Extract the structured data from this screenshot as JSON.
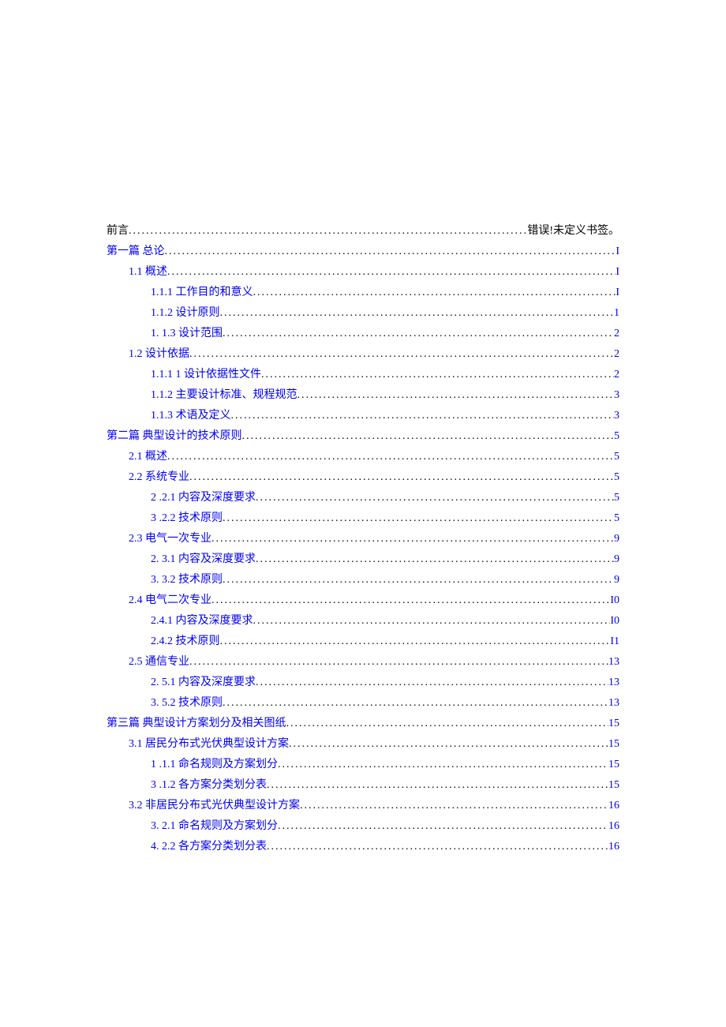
{
  "toc": [
    {
      "indent": 0,
      "title": "前言",
      "page": "错误!未定义书签。",
      "titleLink": false,
      "pageLink": false
    },
    {
      "indent": 0,
      "title": "第一篇 总论",
      "page": "I",
      "titleLink": true,
      "pageLink": true
    },
    {
      "indent": 1,
      "title": "1.1 概述",
      "page": "I",
      "titleLink": true,
      "pageLink": true
    },
    {
      "indent": 2,
      "title": "1.1.1 工作目的和意义",
      "page": "I",
      "titleLink": true,
      "pageLink": true
    },
    {
      "indent": 2,
      "title": "1.1.2 设计原则",
      "page": "1",
      "titleLink": true,
      "pageLink": true
    },
    {
      "indent": 2,
      "title": "1.  1.3 设计范围",
      "page": "2",
      "titleLink": true,
      "pageLink": true
    },
    {
      "indent": 1,
      "title": "1.2 设计依据",
      "page": "2",
      "titleLink": true,
      "pageLink": true
    },
    {
      "indent": 2,
      "title": "1.1.1 1 设计依据性文件",
      "page": "2",
      "titleLink": true,
      "pageLink": true
    },
    {
      "indent": 2,
      "title": "1.1.2  主要设计标准、规程规范",
      "page": "3",
      "titleLink": true,
      "pageLink": true
    },
    {
      "indent": 2,
      "title": "1.1.3  术语及定义",
      "page": "3",
      "titleLink": true,
      "pageLink": true
    },
    {
      "indent": 0,
      "title": "第二篇 典型设计的技术原则",
      "page": "5",
      "titleLink": true,
      "pageLink": true
    },
    {
      "indent": 1,
      "title": "2.1   概述",
      "page": "5",
      "titleLink": true,
      "pageLink": true
    },
    {
      "indent": 1,
      "title": "2.2   系统专业",
      "page": "5",
      "titleLink": true,
      "pageLink": true
    },
    {
      "indent": 2,
      "title": "2  .2.1 内容及深度要求",
      "page": "5",
      "titleLink": true,
      "pageLink": true
    },
    {
      "indent": 2,
      "title": "3  .2.2 技术原则",
      "page": "5",
      "titleLink": true,
      "pageLink": true
    },
    {
      "indent": 1,
      "title": "2.3   电气一次专业",
      "page": "9",
      "titleLink": true,
      "pageLink": true
    },
    {
      "indent": 2,
      "title": "2.  3.1 内容及深度要求",
      "page": "9",
      "titleLink": true,
      "pageLink": true
    },
    {
      "indent": 2,
      "title": "3.  3.2 技术原则",
      "page": "9",
      "titleLink": true,
      "pageLink": true
    },
    {
      "indent": 1,
      "title": "2.4   电气二次专业",
      "page": "I0",
      "titleLink": true,
      "pageLink": true
    },
    {
      "indent": 2,
      "title": "2.4.1 内容及深度要求",
      "page": "I0",
      "titleLink": true,
      "pageLink": true
    },
    {
      "indent": 2,
      "title": "2.4.2 技术原则",
      "page": "I1",
      "titleLink": true,
      "pageLink": true
    },
    {
      "indent": 1,
      "title": "2.5 通信专业",
      "page": "13",
      "titleLink": true,
      "pageLink": true
    },
    {
      "indent": 2,
      "title": "2.  5.1 内容及深度要求",
      "page": "13",
      "titleLink": true,
      "pageLink": true
    },
    {
      "indent": 2,
      "title": "3.  5.2 技术原则",
      "page": "13",
      "titleLink": true,
      "pageLink": true
    },
    {
      "indent": 0,
      "title": "第三篇 典型设计方案划分及相关图纸",
      "page": "15",
      "titleLink": true,
      "pageLink": true
    },
    {
      "indent": 1,
      "title": "3.1   居民分布式光伏典型设计方案",
      "page": "15",
      "titleLink": true,
      "pageLink": true
    },
    {
      "indent": 2,
      "title": "1  .1.1 命名规则及方案划分",
      "page": " 15",
      "titleLink": true,
      "pageLink": true
    },
    {
      "indent": 2,
      "title": "3  .1.2 各方案分类划分表",
      "page": "15",
      "titleLink": true,
      "pageLink": true
    },
    {
      "indent": 1,
      "title": "3.2   非居民分布式光伏典型设计方案",
      "page": "16",
      "titleLink": true,
      "pageLink": true
    },
    {
      "indent": 2,
      "title": "3.  2.1 命名规则及方案划分",
      "page": "16",
      "titleLink": true,
      "pageLink": true
    },
    {
      "indent": 2,
      "title": "4.  2.2 各方案分类划分表",
      "page": "16",
      "titleLink": true,
      "pageLink": true
    }
  ]
}
